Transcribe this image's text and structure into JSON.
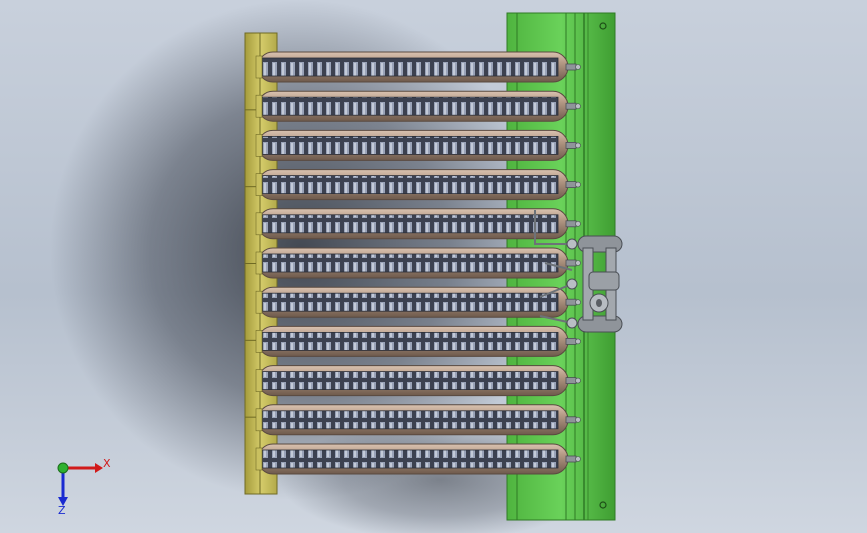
{
  "viewport": {
    "background_top": "#c8d0dc",
    "background_bottom": "#cfd6e0"
  },
  "model": {
    "tube_count": 11,
    "left_block_segments": 6,
    "colors": {
      "mount_plate": "#5bc24b",
      "mount_plate_dark": "#2f7a25",
      "left_block": "#c9c060",
      "left_block_dark": "#6f6a24",
      "tube_body": "#b59a86",
      "tube_dark": "#5a4a40",
      "fin_dark": "#3c4150",
      "fin_light": "#9aa3b8",
      "fitting": "#8f949a",
      "shadow": "#1c2028"
    }
  },
  "triad": {
    "x_label": "X",
    "z_label": "Z",
    "x_color": "#d11a1a",
    "z_color": "#1a2bd1",
    "origin_color": "#2fb12f"
  }
}
